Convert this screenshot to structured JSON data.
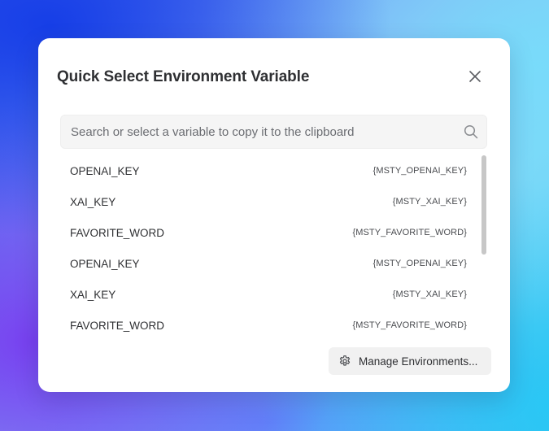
{
  "dialog": {
    "title": "Quick Select Environment Variable",
    "close_icon": "close-icon"
  },
  "search": {
    "placeholder": "Search or select a variable to copy it to the clipboard",
    "value": "",
    "icon": "search-icon"
  },
  "variables": [
    {
      "name": "OPENAI_KEY",
      "ref": "{MSTY_OPENAI_KEY}"
    },
    {
      "name": "XAI_KEY",
      "ref": "{MSTY_XAI_KEY}"
    },
    {
      "name": "FAVORITE_WORD",
      "ref": "{MSTY_FAVORITE_WORD}"
    },
    {
      "name": "OPENAI_KEY",
      "ref": "{MSTY_OPENAI_KEY}"
    },
    {
      "name": "XAI_KEY",
      "ref": "{MSTY_XAI_KEY}"
    },
    {
      "name": "FAVORITE_WORD",
      "ref": "{MSTY_FAVORITE_WORD}"
    }
  ],
  "footer": {
    "manage_label": "Manage Environments...",
    "manage_icon": "gear-icon"
  },
  "colors": {
    "text": "#2f3033",
    "search_bg": "#f5f5f5",
    "button_bg": "#f1f1f1",
    "scrollbar": "#c7c7c7"
  }
}
